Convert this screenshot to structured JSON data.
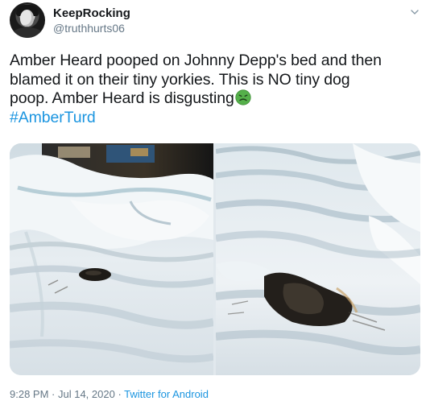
{
  "user": {
    "display_name": "KeepRocking",
    "handle": "@truthhurts06"
  },
  "tweet": {
    "lines": [
      "Amber Heard pooped on Johnny Depp's bed and then",
      "blamed it on their tiny yorkies. This is NO tiny dog",
      "poop. Amber Heard is disgusting"
    ],
    "emoji": "nauseated-face-emoji",
    "hashtag": "#AmberTurd"
  },
  "meta": {
    "time": "9:28 PM",
    "separator_1": " · ",
    "date": "Jul 14, 2020",
    "separator_2": " · ",
    "source": "Twitter for Android"
  },
  "icons": {
    "caret": "chevron-down-icon"
  },
  "colors": {
    "text": "#14171a",
    "muted": "#657786",
    "link": "#1b95e0",
    "emoji": "#4caf50"
  }
}
